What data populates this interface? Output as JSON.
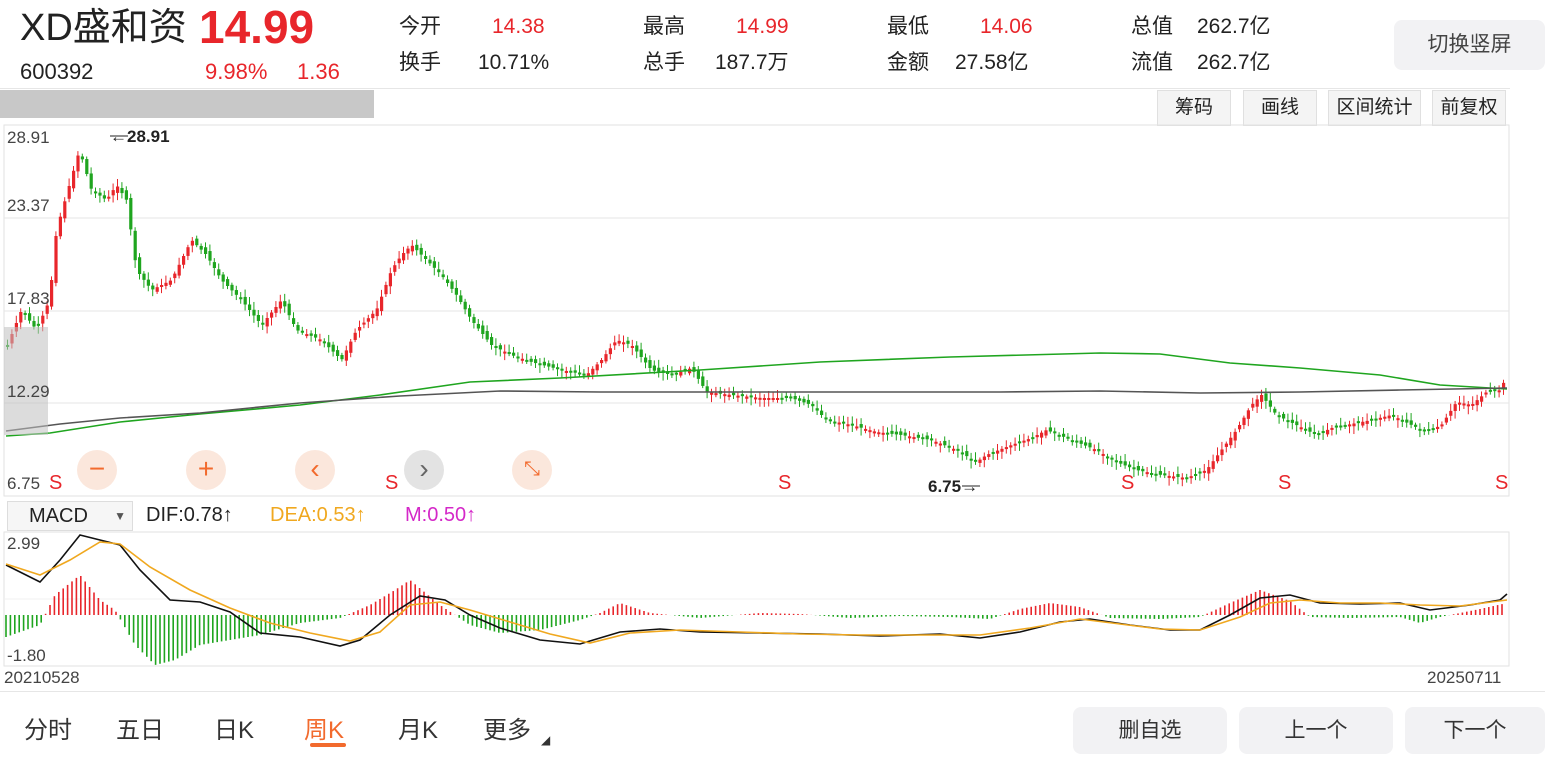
{
  "stock": {
    "name": "XD盛和资",
    "price": "14.99",
    "code": "600392",
    "change_pct": "9.98%",
    "change": "1.36"
  },
  "stats": {
    "open_label": "今开",
    "open": "14.38",
    "high_label": "最高",
    "high": "14.99",
    "low_label": "最低",
    "low": "14.06",
    "total_cap_label": "总值",
    "total_cap": "262.7亿",
    "turnover_label": "换手",
    "turnover": "10.71%",
    "volume_label": "总手",
    "volume": "187.7万",
    "amount_label": "金额",
    "amount": "27.58亿",
    "float_cap_label": "流值",
    "float_cap": "262.7亿"
  },
  "switch_screen": "切换竖屏",
  "chart_tabs": [
    "筹码",
    "画线",
    "区间统计",
    "前复权"
  ],
  "axis": {
    "y_labels": [
      "28.91",
      "23.37",
      "17.83",
      "12.29",
      "6.75"
    ],
    "max_mark": "28.91",
    "min_mark": "6.75",
    "macd_top": "2.99",
    "macd_bottom": "-1.80",
    "date_start": "20210528",
    "date_end": "20250711"
  },
  "s_marker": "S",
  "controls": {
    "zoom_out": "−",
    "zoom_in": "+",
    "prev": "‹",
    "next": "›",
    "shrink": "⤡"
  },
  "indicator": {
    "select": "MACD",
    "dif": "DIF:0.78↑",
    "dea": "DEA:0.53↑",
    "m": "M:0.50↑"
  },
  "bottom_tabs": [
    "分时",
    "五日",
    "日K",
    "周K",
    "月K",
    "更多"
  ],
  "active_tab": "周K",
  "actions": {
    "remove": "删自选",
    "prev": "上一个",
    "next": "下一个"
  },
  "colors": {
    "up": "#e8262b",
    "down": "#1fa51f",
    "ma_long": "#1fa51f",
    "ma_short": "#555555",
    "dea": "#f0a81f",
    "m": "#d428c8",
    "accent": "#f26a2d"
  },
  "chart_data": {
    "type": "candlestick",
    "ylim": [
      6.75,
      28.91
    ],
    "macd_ylim": [
      -1.8,
      2.99
    ],
    "x_range": [
      "20210528",
      "20250711"
    ]
  }
}
